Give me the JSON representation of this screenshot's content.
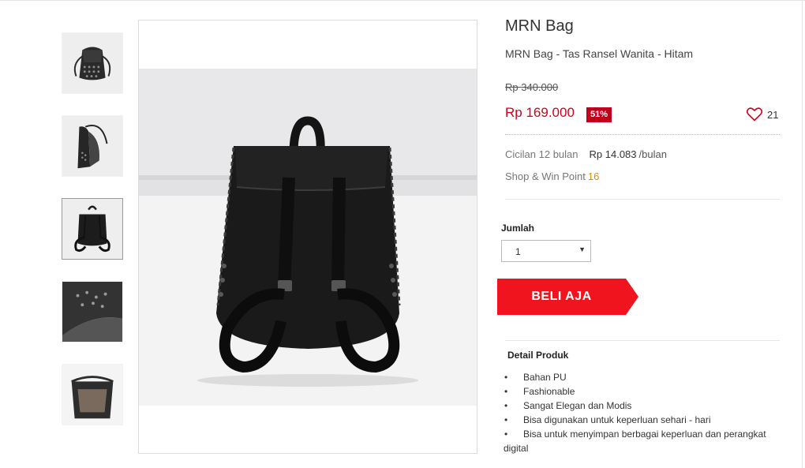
{
  "product": {
    "brand": "MRN Bag",
    "title": "MRN Bag - Tas Ransel Wanita - Hitam"
  },
  "pricing": {
    "old_price": "Rp 340.000",
    "new_price": "Rp 169.000",
    "discount": "51%",
    "wishlist_count": "21",
    "accent_color": "#d0021b"
  },
  "installment": {
    "label": "Cicilan 12 bulan",
    "amount": "Rp 14.083",
    "unit": "/bulan"
  },
  "points": {
    "label": "Shop & Win Point",
    "value": "16"
  },
  "quantity": {
    "label": "Jumlah",
    "value": "1"
  },
  "buy_button": {
    "label": "BELI AJA",
    "color": "#f0141e"
  },
  "details": {
    "title": "Detail Produk",
    "items": [
      "Bahan PU",
      "Fashionable",
      "Sangat Elegan dan Modis",
      "Bisa digunakan untuk keperluan sehari - hari",
      "Bisa untuk menyimpan berbagai keperluan dan perangkat digital"
    ]
  },
  "gallery": {
    "selected_index": 2,
    "thumbnail_count": 5
  },
  "icons": {
    "wishlist": "heart-icon",
    "dropdown": "chevron-down-icon"
  }
}
